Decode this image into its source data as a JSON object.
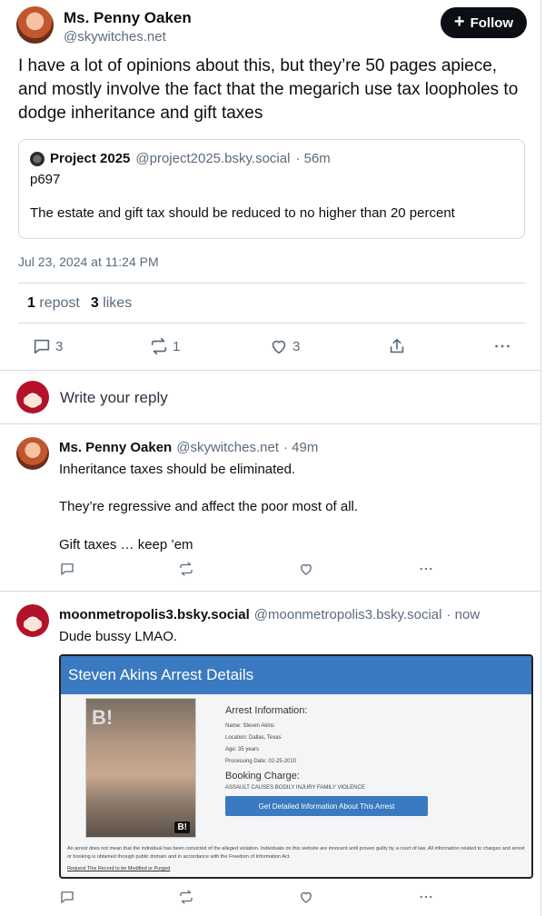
{
  "main_post": {
    "author_name": "Ms. Penny Oaken",
    "author_handle": "@skywitches.net",
    "follow_label": "Follow",
    "text": "I have a lot of opinions about this, but they’re 50 pages apiece, and mostly involve the fact that the megarich use tax loopholes to dodge inheritance and gift taxes",
    "quote": {
      "author_name": "Project 2025",
      "author_handle": "@project2025.bsky.social",
      "time": "· 56m",
      "line1": "p697",
      "line2": "The estate and gift tax should be reduced to no higher than 20 percent"
    },
    "timestamp": "Jul 23, 2024 at 11:24 PM",
    "stats": {
      "reposts_count": "1",
      "reposts_label": "repost",
      "likes_count": "3",
      "likes_label": "likes"
    },
    "actions": {
      "replies": "3",
      "reposts": "1",
      "likes": "3"
    }
  },
  "reply_prompt": "Write your reply",
  "replies": [
    {
      "author_name": "Ms. Penny Oaken",
      "author_handle": "@skywitches.net",
      "time": "· 49m",
      "para1": "Inheritance taxes should be eliminated.",
      "para2": "They’re regressive and affect the poor most of all.",
      "para3": "Gift taxes … keep ’em"
    },
    {
      "author_name": "moonmetropolis3.bsky.social",
      "author_handle": "@moonmetropolis3.bsky.social",
      "time": "· now",
      "text": "Dude bussy LMAO.",
      "embed": {
        "title": "Steven Akins Arrest Details",
        "info_title": "Arrest Information:",
        "name": "Name: Steven Akins",
        "location": "Location: Dallas, Texas",
        "age": "Age: 35 years",
        "processing": "Processing Date: 02-25-2010",
        "booking_title": "Booking Charge:",
        "charge": "ASSAULT CAUSES BODILY INJURY FAMILY VIOLENCE",
        "button": "Get Detailed Information About This Arrest",
        "badge": "B!",
        "disclaimer": "An arrest does not mean that the individual has been convicted of the alleged violation. Individuals on this website are innocent until proven guilty by a court of law. All information related to charges and arrest or booking is obtained through public domain and in accordance with the Freedom of Information Act.",
        "link": "Request This Record to be Modified or Purged"
      }
    }
  ],
  "icons": [
    "reply-icon",
    "repost-icon",
    "like-icon",
    "share-icon",
    "more-icon",
    "plus-icon"
  ],
  "colors": {
    "accent": "#0b0f14",
    "muted": "#5b6b7c",
    "border": "#d4dbe2",
    "embed_blue": "#3a7ac0"
  }
}
